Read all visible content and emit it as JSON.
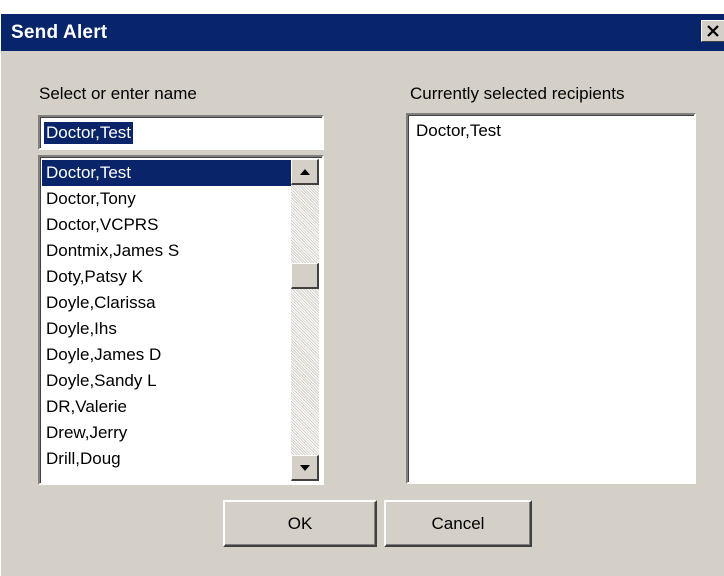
{
  "window": {
    "title": "Send Alert",
    "close_glyph": "✕"
  },
  "left": {
    "label": "Select or enter name",
    "input_value": "Doctor,Test",
    "list": [
      "Doctor,Test",
      "Doctor,Tony",
      "Doctor,VCPRS",
      "Dontmix,James S",
      "Doty,Patsy K",
      "Doyle,Clarissa",
      "Doyle,Ihs",
      "Doyle,James D",
      "Doyle,Sandy L",
      "DR,Valerie",
      "Drew,Jerry",
      "Drill,Doug"
    ],
    "selected_index": 0
  },
  "right": {
    "label": "Currently selected recipients",
    "recipients": [
      "Doctor,Test"
    ]
  },
  "buttons": {
    "ok": "OK",
    "cancel": "Cancel"
  },
  "colors": {
    "title_bar": "#08246b",
    "selection": "#0a246a",
    "dialog_face": "#d4d0c8"
  },
  "icons": {
    "close": "close-icon",
    "scroll_up": "scroll-up-arrow-icon",
    "scroll_down": "scroll-down-arrow-icon"
  }
}
